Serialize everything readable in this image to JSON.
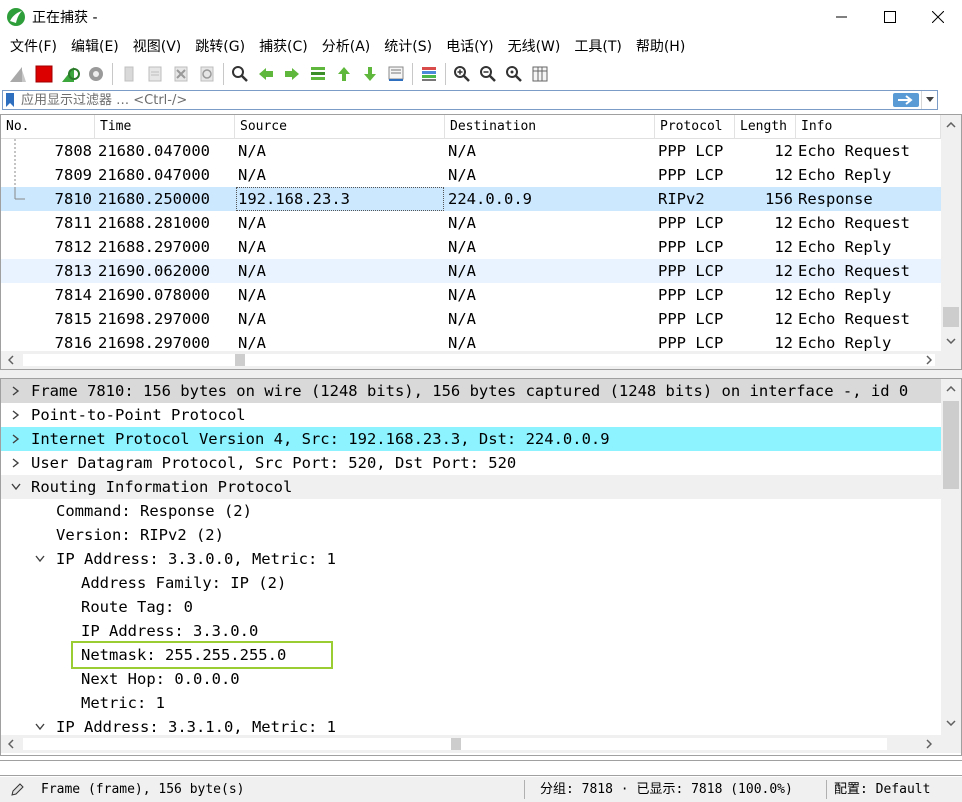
{
  "window": {
    "title": "正在捕获 -"
  },
  "menu": [
    "文件(F)",
    "编辑(E)",
    "视图(V)",
    "跳转(G)",
    "捕获(C)",
    "分析(A)",
    "统计(S)",
    "电话(Y)",
    "无线(W)",
    "工具(T)",
    "帮助(H)"
  ],
  "toolbar": {
    "icons": [
      "shark-fin-start-icon",
      "stop-capture-icon",
      "restart-capture-icon",
      "capture-options-icon",
      "open-file-icon",
      "save-file-icon",
      "close-file-icon",
      "reload-file-icon",
      "find-packet-icon",
      "go-back-icon",
      "go-forward-icon",
      "go-to-packet-icon",
      "go-first-icon",
      "go-last-icon",
      "autoscroll-icon",
      "colorize-icon",
      "zoom-in-icon",
      "zoom-out-icon",
      "zoom-normal-icon",
      "resize-columns-icon"
    ]
  },
  "filter": {
    "placeholder": "应用显示过滤器 … <Ctrl-/>"
  },
  "packet_list": {
    "columns": [
      "No.",
      "Time",
      "Source",
      "Destination",
      "Protocol",
      "Length",
      "Info"
    ],
    "rows": [
      {
        "no": "7808",
        "time": "21680.047000",
        "source": "N/A",
        "destination": "N/A",
        "protocol": "PPP LCP",
        "length": "12",
        "info": "Echo Request",
        "state": "normal"
      },
      {
        "no": "7809",
        "time": "21680.047000",
        "source": "N/A",
        "destination": "N/A",
        "protocol": "PPP LCP",
        "length": "12",
        "info": "Echo Reply",
        "state": "normal"
      },
      {
        "no": "7810",
        "time": "21680.250000",
        "source": "192.168.23.3",
        "destination": "224.0.0.9",
        "protocol": "RIPv2",
        "length": "156",
        "info": "Response",
        "state": "selected"
      },
      {
        "no": "7811",
        "time": "21688.281000",
        "source": "N/A",
        "destination": "N/A",
        "protocol": "PPP LCP",
        "length": "12",
        "info": "Echo Request",
        "state": "normal"
      },
      {
        "no": "7812",
        "time": "21688.297000",
        "source": "N/A",
        "destination": "N/A",
        "protocol": "PPP LCP",
        "length": "12",
        "info": "Echo Reply",
        "state": "normal"
      },
      {
        "no": "7813",
        "time": "21690.062000",
        "source": "N/A",
        "destination": "N/A",
        "protocol": "PPP LCP",
        "length": "12",
        "info": "Echo Request",
        "state": "alt"
      },
      {
        "no": "7814",
        "time": "21690.078000",
        "source": "N/A",
        "destination": "N/A",
        "protocol": "PPP LCP",
        "length": "12",
        "info": "Echo Reply",
        "state": "normal"
      },
      {
        "no": "7815",
        "time": "21698.297000",
        "source": "N/A",
        "destination": "N/A",
        "protocol": "PPP LCP",
        "length": "12",
        "info": "Echo Request",
        "state": "normal"
      },
      {
        "no": "7816",
        "time": "21698.297000",
        "source": "N/A",
        "destination": "N/A",
        "protocol": "PPP LCP",
        "length": "12",
        "info": "Echo Reply",
        "state": "normal"
      }
    ]
  },
  "details": [
    {
      "text": "Frame 7810: 156 bytes on wire (1248 bits), 156 bytes captured (1248 bits) on interface -, id 0",
      "level": 0,
      "expander": "collapsed",
      "style": "gray"
    },
    {
      "text": "Point-to-Point Protocol",
      "level": 0,
      "expander": "collapsed",
      "style": "none"
    },
    {
      "text": "Internet Protocol Version 4, Src: 192.168.23.3, Dst: 224.0.0.9",
      "level": 0,
      "expander": "collapsed",
      "style": "cyan"
    },
    {
      "text": "User Datagram Protocol, Src Port: 520, Dst Port: 520",
      "level": 0,
      "expander": "collapsed",
      "style": "none"
    },
    {
      "text": "Routing Information Protocol",
      "level": 0,
      "expander": "expanded",
      "style": "light"
    },
    {
      "text": "Command: Response (2)",
      "level": 1,
      "expander": "none",
      "style": "none"
    },
    {
      "text": "Version: RIPv2 (2)",
      "level": 1,
      "expander": "none",
      "style": "none"
    },
    {
      "text": "IP Address: 3.3.0.0, Metric: 1",
      "level": 1,
      "expander": "expanded",
      "style": "none"
    },
    {
      "text": "Address Family: IP (2)",
      "level": 2,
      "expander": "none",
      "style": "none"
    },
    {
      "text": "Route Tag: 0",
      "level": 2,
      "expander": "none",
      "style": "none"
    },
    {
      "text": "IP Address: 3.3.0.0",
      "level": 2,
      "expander": "none",
      "style": "none"
    },
    {
      "text": "Netmask: 255.255.255.0",
      "level": 2,
      "expander": "none",
      "style": "none"
    },
    {
      "text": "Next Hop: 0.0.0.0",
      "level": 2,
      "expander": "none",
      "style": "none"
    },
    {
      "text": "Metric: 1",
      "level": 2,
      "expander": "none",
      "style": "none"
    },
    {
      "text": "IP Address: 3.3.1.0, Metric: 1",
      "level": 1,
      "expander": "expanded",
      "style": "none"
    }
  ],
  "status": {
    "frame_info": "Frame (frame), 156 byte(s)",
    "packets": "分组: 7818 · 已显示: 7818 (100.0%)",
    "profile": "配置: Default"
  },
  "colors": {
    "selected_row": "#cce8ff",
    "alt_row": "#e8f3ff",
    "highlight_cyan": "#8cf3ff",
    "netmask_box": "#9acd32",
    "stop_red": "#dd0000"
  }
}
